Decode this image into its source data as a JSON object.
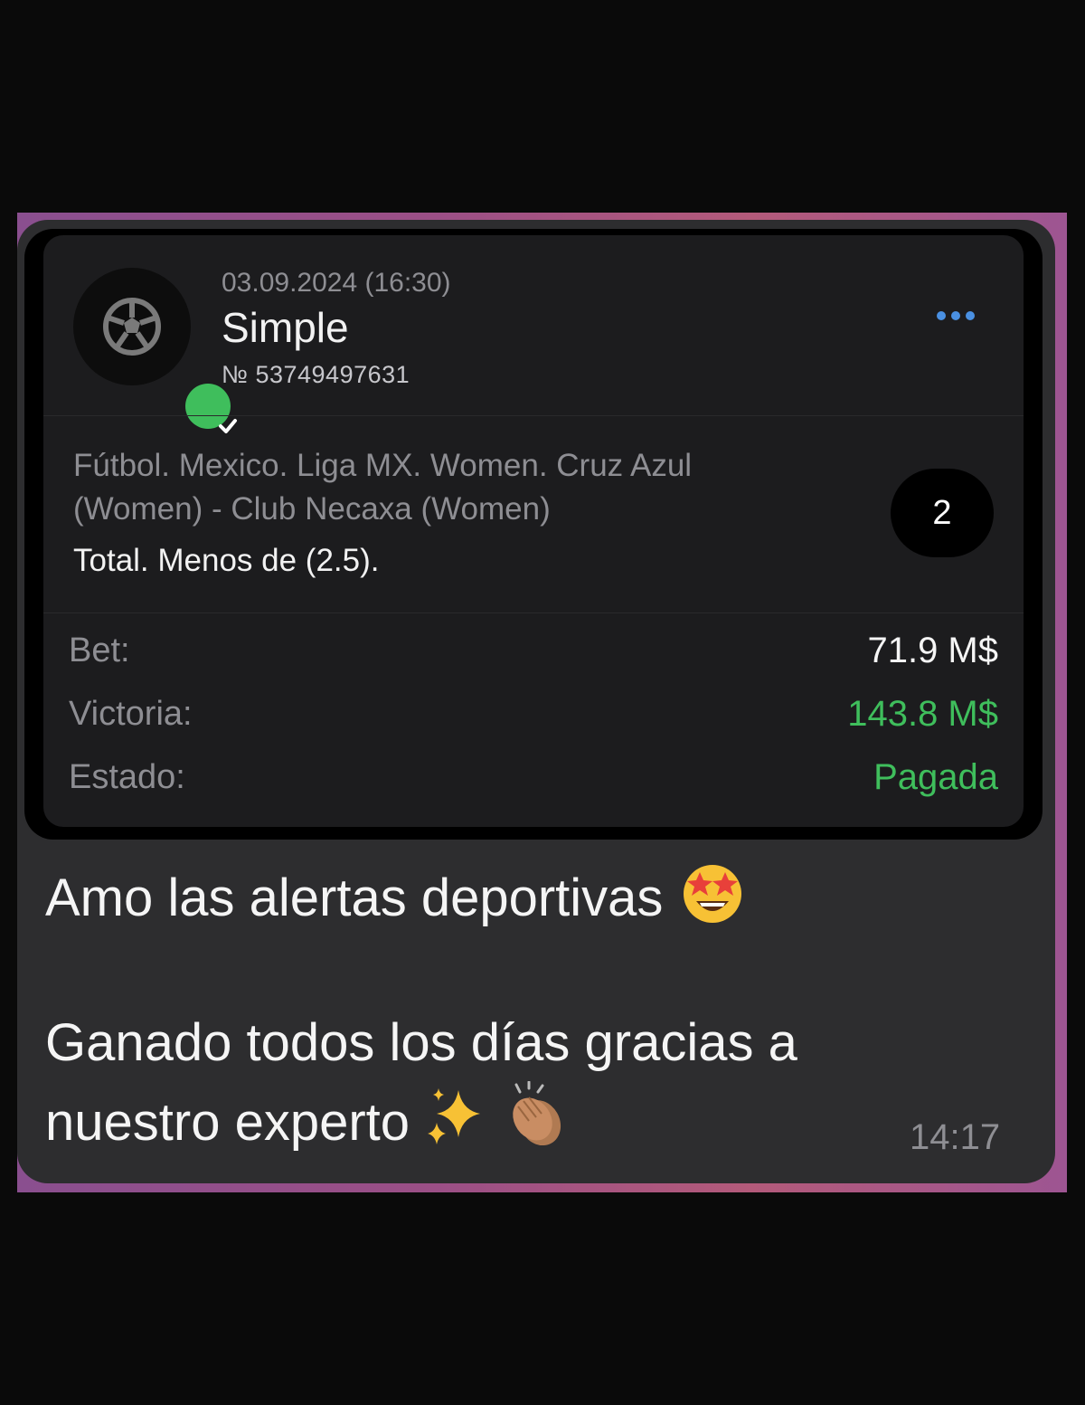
{
  "bet_card": {
    "date": "03.09.2024 (16:30)",
    "type": "Simple",
    "number": "№ 53749497631",
    "event": "Fútbol. Mexico. Liga MX. Women. Cruz Azul (Women) - Club Necaxa (Women)",
    "market": "Total. Menos de (2.5).",
    "odds_badge": "2",
    "rows": [
      {
        "label": "Bet:",
        "value": "71.9 M$",
        "color": "#f5f5f5"
      },
      {
        "label": "Victoria:",
        "value": "143.8 M$",
        "color": "#3fbe5c"
      },
      {
        "label": "Estado:",
        "value": "Pagada",
        "color": "#3fbe5c"
      }
    ],
    "icons": {
      "avatar": "soccer-ball-icon",
      "verified": "check-icon",
      "menu": "more-dots-icon"
    }
  },
  "message": {
    "line1": "Amo  las alertas deportivas",
    "line2": "Ganado todos los días gracias a",
    "line3": "nuestro experto",
    "emojis": [
      "star-struck-icon",
      "sparkles-icon",
      "clapping-hands-icon"
    ],
    "time": "14:17"
  },
  "colors": {
    "accent_green": "#3fbe5c",
    "link_blue": "#4a90e2",
    "bubble": "#2d2d2f"
  }
}
